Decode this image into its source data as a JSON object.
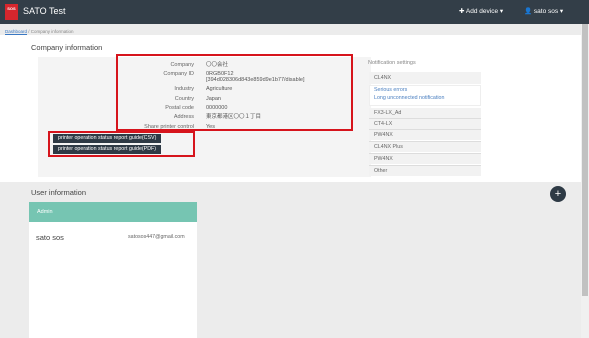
{
  "app": {
    "logo_text": "SOS",
    "title": "SATO Test",
    "add_device": "✚ Add device ▾",
    "user_menu": "👤 sato sos ▾"
  },
  "breadcrumb": {
    "home": "Dashboard",
    "separator": " / ",
    "current": "Company information"
  },
  "company": {
    "section_title": "Company information",
    "rows": [
      {
        "label": "Company",
        "value": "〇〇会社"
      },
      {
        "label": "Company ID",
        "value": "0RGB0F12"
      },
      {
        "label": "",
        "value": "[394d028306d843e859d9e1b77/disable]"
      },
      {
        "label": "Industry",
        "value": "Agriculture"
      },
      {
        "label": "Country",
        "value": "Japan"
      },
      {
        "label": "Postal code",
        "value": "0000000"
      },
      {
        "label": "Address",
        "value": "東京都港区〇〇１丁目"
      },
      {
        "label": "Share printer control",
        "value": "Yes"
      }
    ],
    "btn_csv": "printer operation status report guide(CSV)",
    "btn_pdf": "printer operation status report guide(PDF)"
  },
  "notifications": {
    "title": "Notification settings",
    "items": [
      {
        "label": "CL4NX"
      },
      {
        "label": "Serious errors"
      },
      {
        "label": "Long unconnected notification"
      },
      {
        "label": "FX3-LX_Ad"
      },
      {
        "label": "CT4-LX"
      },
      {
        "label": "PW4NX"
      },
      {
        "label": "CL4NX Plus"
      },
      {
        "label": "PW4NX"
      },
      {
        "label": "Other"
      }
    ]
  },
  "users": {
    "section_title": "User information",
    "add_icon": "+",
    "role": "Admin",
    "name": "sato sos",
    "email": "satosos447@gmail.com"
  },
  "colors": {
    "topbar": "#333e48",
    "highlight": "#d6141c",
    "admin_header": "#76c5b2",
    "dark_button": "#2e3a45"
  }
}
